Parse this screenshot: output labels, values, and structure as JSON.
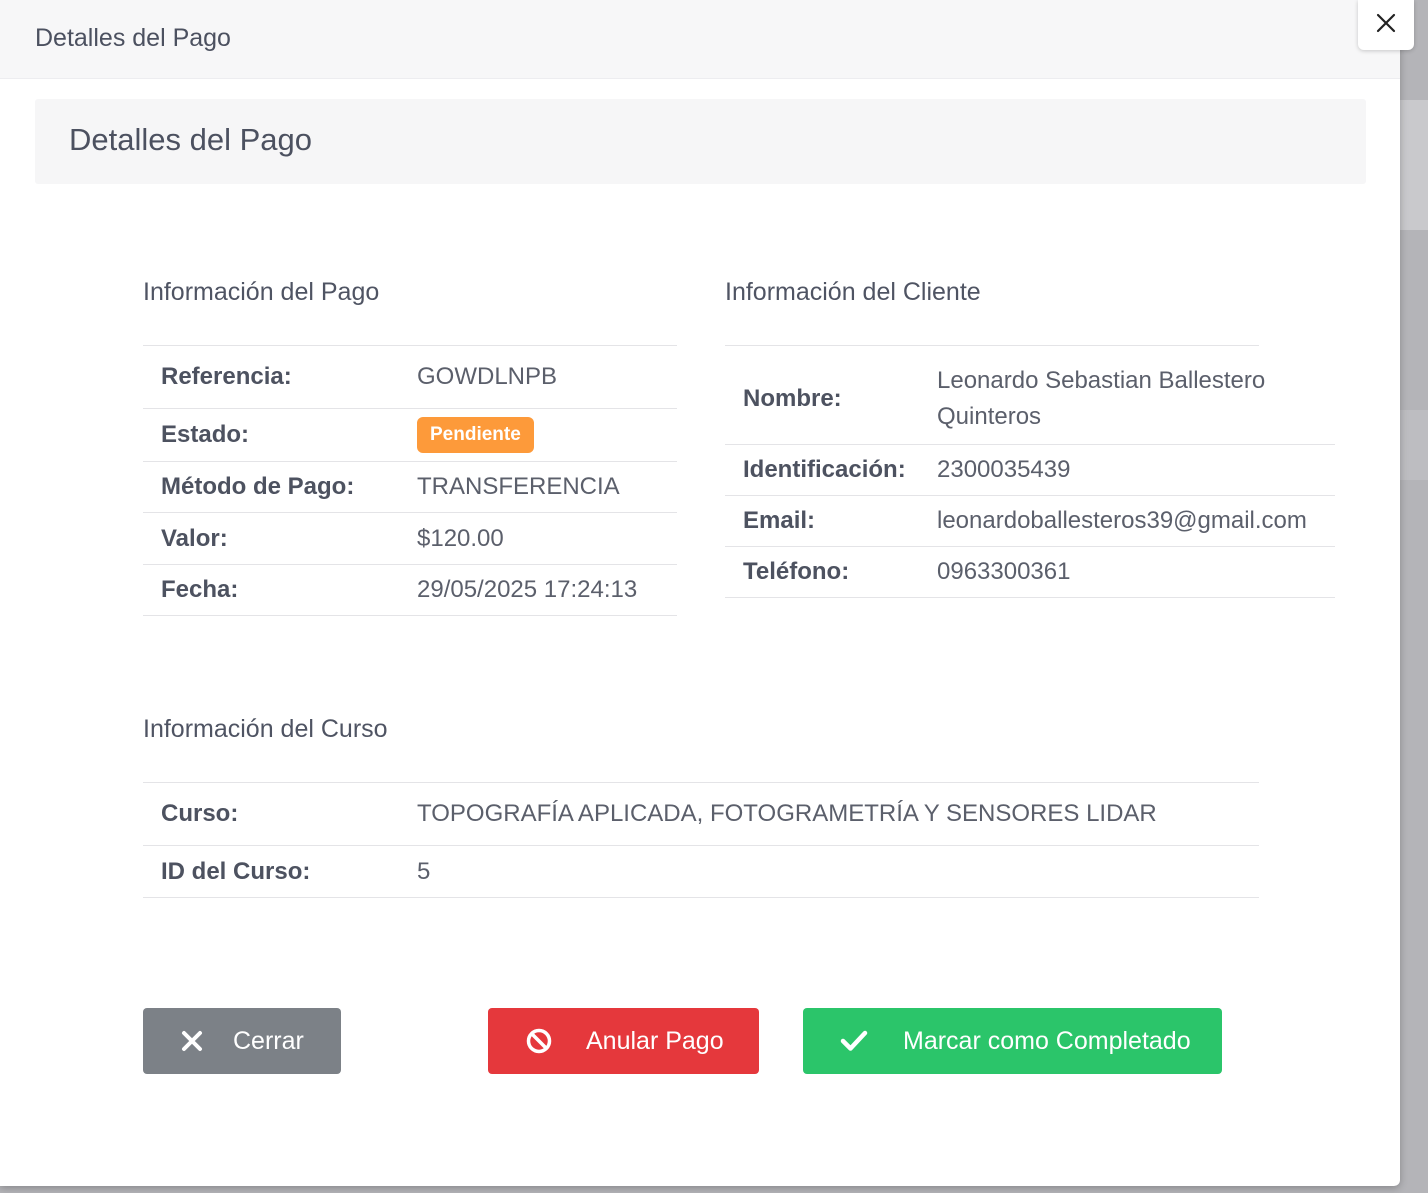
{
  "modal": {
    "header_title": "Detalles del Pago",
    "card_title": "Detalles del Pago"
  },
  "payment_info": {
    "title": "Información del Pago",
    "rows": [
      {
        "label": "Referencia:",
        "value": "GOWDLNPB"
      },
      {
        "label": "Estado:",
        "value": "Pendiente"
      },
      {
        "label": "Método de Pago:",
        "value": "TRANSFERENCIA"
      },
      {
        "label": "Valor:",
        "value": "$120.00"
      },
      {
        "label": "Fecha:",
        "value": "29/05/2025 17:24:13"
      }
    ]
  },
  "client_info": {
    "title": "Información del Cliente",
    "rows": [
      {
        "label": "Nombre:",
        "value": "Leonardo Sebastian Ballestero Quinteros"
      },
      {
        "label": "Identificación:",
        "value": "2300035439"
      },
      {
        "label": "Email:",
        "value": "leonardoballesteros39@gmail.com"
      },
      {
        "label": "Teléfono:",
        "value": "0963300361"
      }
    ]
  },
  "course_info": {
    "title": "Información del Curso",
    "rows": [
      {
        "label": "Curso:",
        "value": "TOPOGRAFÍA APLICADA, FOTOGRAMETRÍA Y SENSORES LIDAR"
      },
      {
        "label": "ID del Curso:",
        "value": "5"
      }
    ]
  },
  "buttons": {
    "close": "Cerrar",
    "void": "Anular Pago",
    "complete": "Marcar como Completado"
  },
  "colors": {
    "status_badge": "#fd9a3a",
    "close_button": "#7c8187",
    "void_button": "#e5383c",
    "complete_button": "#2bc56a"
  },
  "icons": {
    "dismiss": "close-icon",
    "close_button": "times-icon",
    "void_button": "ban-icon",
    "complete_button": "check-icon"
  }
}
